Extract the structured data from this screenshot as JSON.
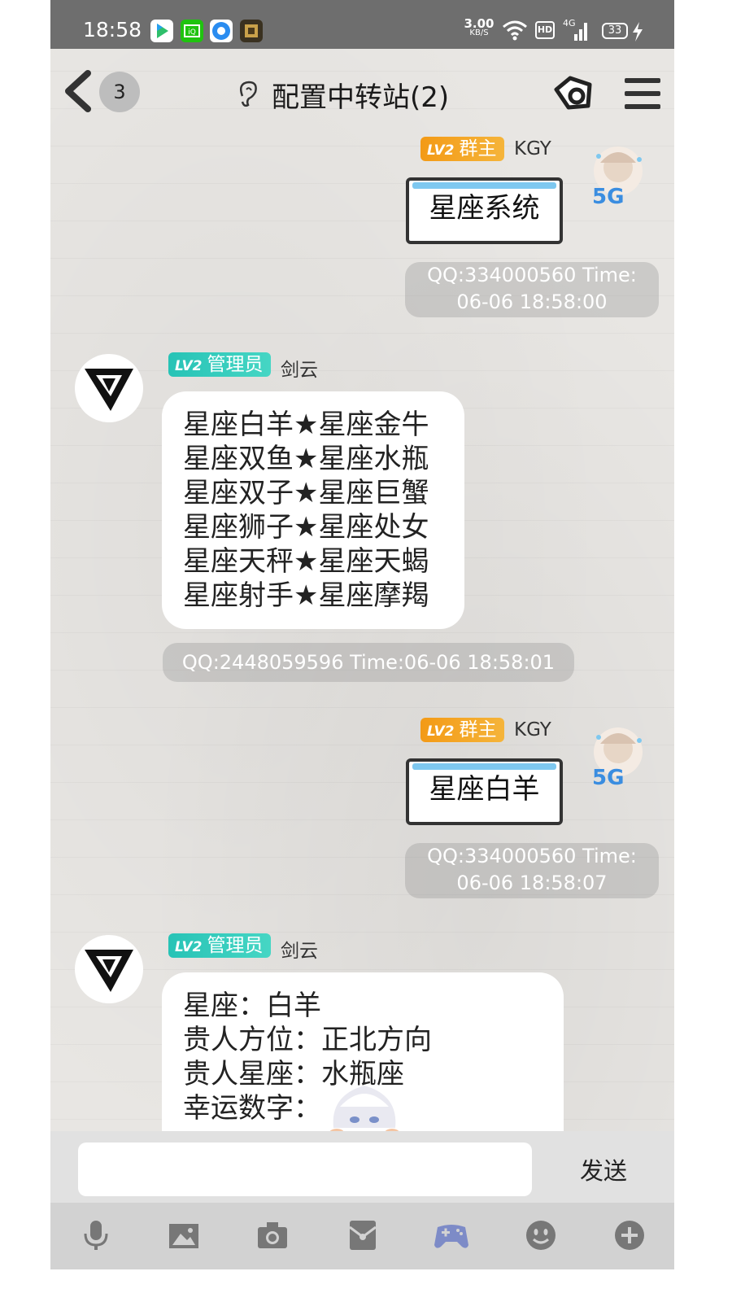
{
  "status_bar": {
    "time": "18:58",
    "net_speed_value": "3.00",
    "net_speed_unit": "KB/S",
    "hd": "HD",
    "network": "4G",
    "battery": "33"
  },
  "header": {
    "unread_count": "3",
    "title": "配置中转站(2)"
  },
  "messages": [
    {
      "sender_level": "LV2",
      "sender_role": "群主",
      "sender_name": "KGY",
      "avatar_badge": "5G",
      "command": "星座系统",
      "meta_line1": "QQ:334000560  Time:",
      "meta_line2": "06-06 18:58:00"
    },
    {
      "sender_level": "LV2",
      "sender_role": "管理员",
      "sender_name": "剑云",
      "lines": [
        "星座白羊★星座金牛",
        "星座双鱼★星座水瓶",
        "星座双子★星座巨蟹",
        "星座狮子★星座处女",
        "星座天秤★星座天蝎",
        "星座射手★星座摩羯"
      ],
      "meta_line1": "QQ:2448059596  Time:06-06 18:58:01"
    },
    {
      "sender_level": "LV2",
      "sender_role": "群主",
      "sender_name": "KGY",
      "avatar_badge": "5G",
      "command": "星座白羊",
      "meta_line1": "QQ:334000560  Time:",
      "meta_line2": "06-06 18:58:07"
    },
    {
      "sender_level": "LV2",
      "sender_role": "管理员",
      "sender_name": "剑云",
      "lines": [
        "星座：白羊",
        "贵人方位：正北方向",
        "贵人星座：水瓶座",
        "幸运数字："
      ]
    }
  ],
  "input": {
    "send_label": "发送"
  },
  "toolbar_icons": [
    "mic-icon",
    "image-icon",
    "camera-icon",
    "red-packet-icon",
    "gamepad-icon",
    "emoji-icon",
    "plus-icon"
  ]
}
